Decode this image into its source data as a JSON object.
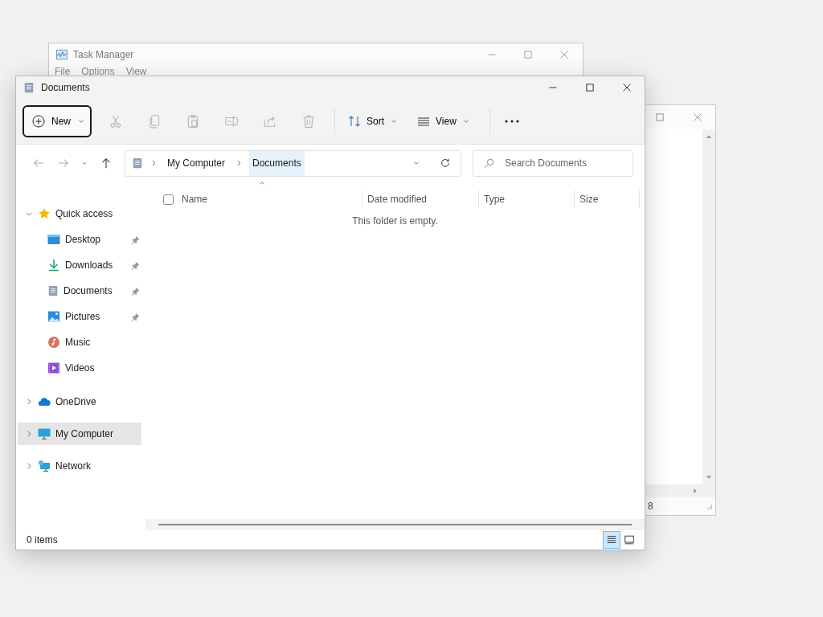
{
  "background_window": {
    "title": "Task Manager",
    "menu": [
      "File",
      "Options",
      "View"
    ]
  },
  "right_window": {
    "status_text": "8"
  },
  "window": {
    "title": "Documents"
  },
  "toolbar": {
    "new_label": "New",
    "actions": [
      {
        "kind": "cut",
        "disabled": true
      },
      {
        "kind": "copy",
        "disabled": true
      },
      {
        "kind": "paste",
        "disabled": true
      },
      {
        "kind": "rename",
        "disabled": true
      },
      {
        "kind": "share",
        "disabled": true
      },
      {
        "kind": "delete",
        "disabled": true
      }
    ],
    "sort_label": "Sort",
    "view_label": "View"
  },
  "address_bar": {
    "breadcrumbs": [
      {
        "label": "My Computer",
        "selected": false
      },
      {
        "label": "Documents",
        "selected": true
      }
    ]
  },
  "search": {
    "placeholder": "Search Documents"
  },
  "select_all": {
    "checked": false
  },
  "columns": [
    "Name",
    "Date modified",
    "Type",
    "Size"
  ],
  "empty_message": "This folder is empty.",
  "nav": [
    {
      "label": "Quick access",
      "kind": "star",
      "expanded": true,
      "selected": false,
      "children": [
        {
          "label": "Desktop",
          "kind": "desktop",
          "pinned": true
        },
        {
          "label": "Downloads",
          "kind": "downloads",
          "pinned": true
        },
        {
          "label": "Documents",
          "kind": "documents",
          "pinned": true
        },
        {
          "label": "Pictures",
          "kind": "pictures",
          "pinned": true
        },
        {
          "label": "Music",
          "kind": "music",
          "pinned": false
        },
        {
          "label": "Videos",
          "kind": "videos",
          "pinned": false
        }
      ]
    },
    {
      "label": "OneDrive",
      "kind": "cloud",
      "expanded": false,
      "selected": false
    },
    {
      "label": "My Computer",
      "kind": "computer",
      "expanded": false,
      "selected": true
    },
    {
      "label": "Network",
      "kind": "network",
      "expanded": false,
      "selected": false
    }
  ],
  "status_bar": {
    "item_count": "0 items"
  },
  "view_buttons": [
    {
      "kind": "details",
      "selected": true
    },
    {
      "kind": "tiles",
      "selected": false
    }
  ]
}
